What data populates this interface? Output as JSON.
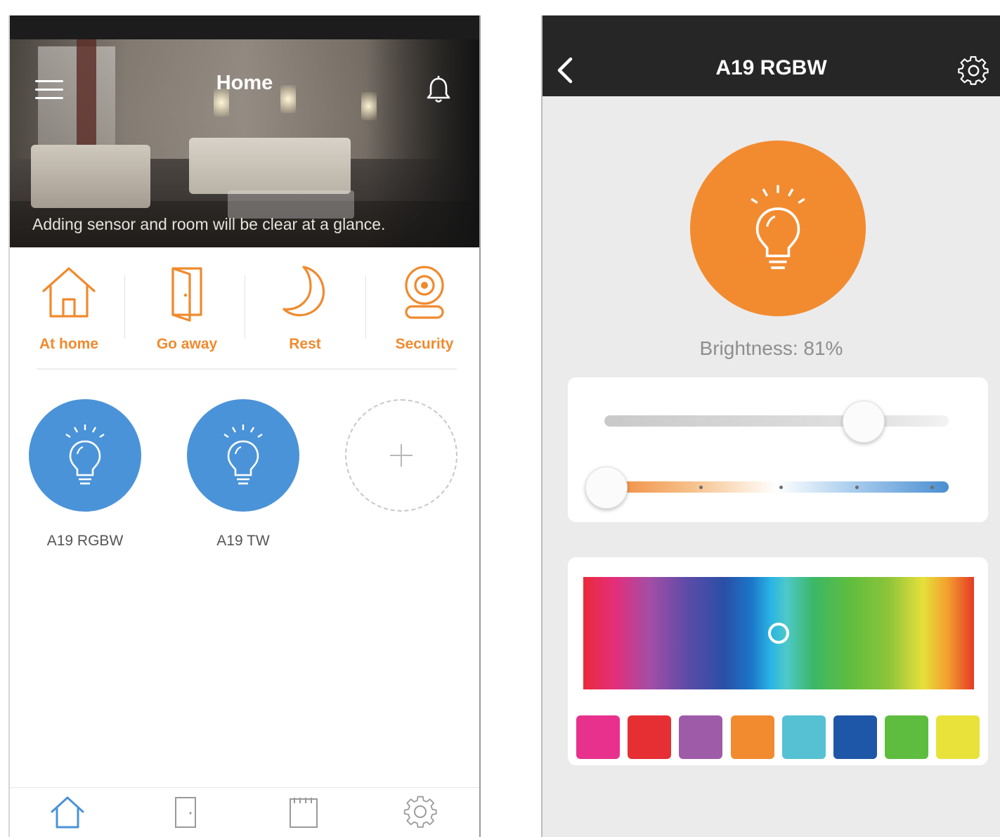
{
  "left": {
    "header": {
      "title": "Home",
      "caption": "Adding sensor and room will be clear at a glance."
    },
    "modes": [
      {
        "label": "At home",
        "icon": "house-icon"
      },
      {
        "label": "Go away",
        "icon": "door-icon"
      },
      {
        "label": "Rest",
        "icon": "moon-icon"
      },
      {
        "label": "Security",
        "icon": "camera-icon"
      }
    ],
    "devices": [
      {
        "name": "A19 RGBW",
        "icon": "bulb-icon"
      },
      {
        "name": "A19 TW",
        "icon": "bulb-icon"
      }
    ],
    "add_icon": "plus-icon",
    "tabs": [
      {
        "icon": "house-icon",
        "active": true
      },
      {
        "icon": "door-icon",
        "active": false
      },
      {
        "icon": "calendar-icon",
        "active": false
      },
      {
        "icon": "gear-icon",
        "active": false
      }
    ],
    "colors": {
      "accent": "#f08a2e",
      "device": "#4a93d8",
      "tab_active": "#4a93d8",
      "tab_inactive": "#9a9a9a"
    }
  },
  "right": {
    "title": "A19 RGBW",
    "brightness_label": "Brightness:  81%",
    "brightness_value": 81,
    "temperature_value": 0,
    "picker": {
      "hue_fraction": 0.5,
      "lightness_fraction": 0.5
    },
    "swatches": [
      "#e8318d",
      "#e52f33",
      "#9e5ba8",
      "#f28b30",
      "#55c1d3",
      "#1f57a8",
      "#5ebd3f",
      "#e8e23b"
    ],
    "colors": {
      "bulb": "#f28b30",
      "navbar": "#262626",
      "background": "#ebebeb"
    }
  }
}
